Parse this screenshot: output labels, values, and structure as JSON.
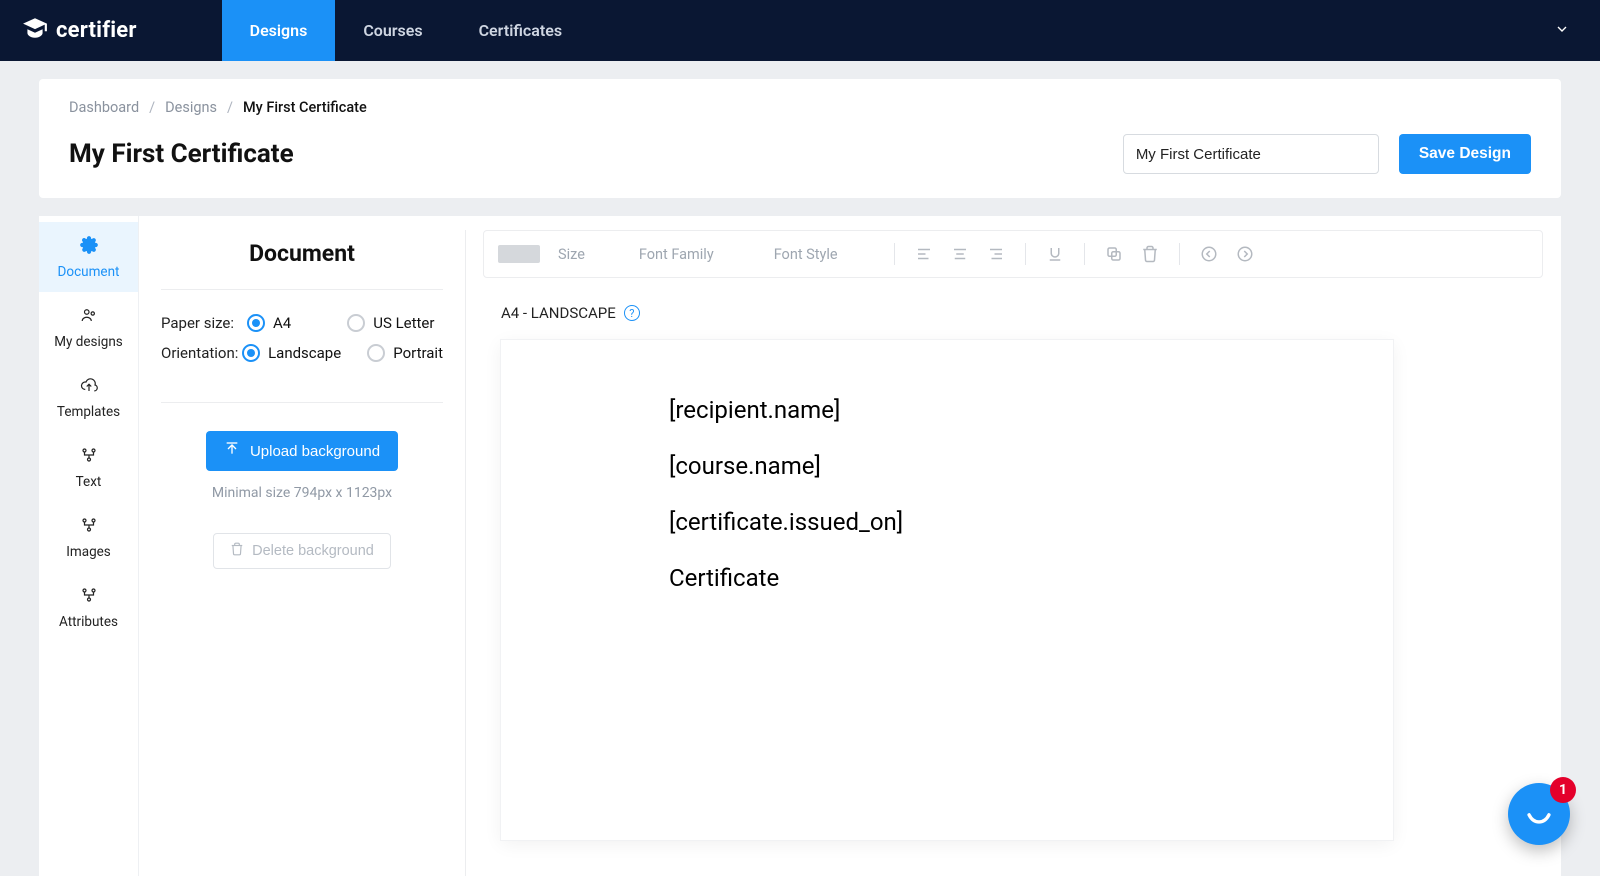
{
  "brand": "certifier",
  "nav": {
    "tabs": [
      {
        "label": "Designs",
        "active": true
      },
      {
        "label": "Courses",
        "active": false
      },
      {
        "label": "Certificates",
        "active": false
      }
    ]
  },
  "breadcrumb": {
    "items": [
      "Dashboard",
      "Designs"
    ],
    "current": "My First Certificate"
  },
  "header": {
    "title": "My First Certificate",
    "name_input_value": "My First Certificate",
    "save_label": "Save Design"
  },
  "sidebar": {
    "items": [
      {
        "label": "Document",
        "icon": "gear-icon",
        "active": true
      },
      {
        "label": "My designs",
        "icon": "user-pair-icon",
        "active": false
      },
      {
        "label": "Templates",
        "icon": "cloud-upload-icon",
        "active": false
      },
      {
        "label": "Text",
        "icon": "nodes-icon",
        "active": false
      },
      {
        "label": "Images",
        "icon": "nodes-icon",
        "active": false
      },
      {
        "label": "Attributes",
        "icon": "nodes-icon",
        "active": false
      }
    ]
  },
  "panel": {
    "title": "Document",
    "paper_size_label": "Paper size:",
    "orientation_label": "Orientation:",
    "paper_sizes": [
      {
        "label": "A4",
        "checked": true
      },
      {
        "label": "US Letter",
        "checked": false
      }
    ],
    "orientations": [
      {
        "label": "Landscape",
        "checked": true
      },
      {
        "label": "Portrait",
        "checked": false
      }
    ],
    "upload_label": "Upload background",
    "upload_hint": "Minimal size 794px x 1123px",
    "delete_label": "Delete background"
  },
  "toolbar": {
    "size_label": "Size",
    "font_family_label": "Font Family",
    "font_style_label": "Font Style"
  },
  "canvas": {
    "label": "A4 - LANDSCAPE",
    "lines": [
      "[recipient.name]",
      "[course.name]",
      "[certificate.issued_on]",
      "Certificate"
    ]
  },
  "chat": {
    "badge": "1"
  }
}
